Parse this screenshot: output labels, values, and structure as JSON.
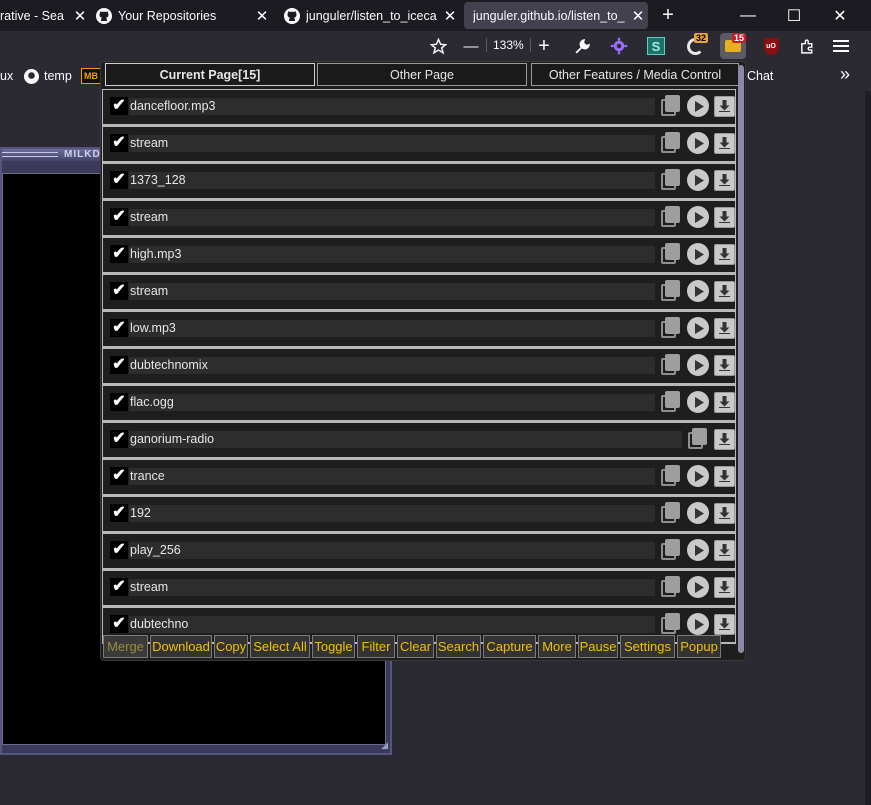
{
  "browser": {
    "tabs": [
      {
        "title": "rative - Sea",
        "active": false
      },
      {
        "title": "Your Repositories",
        "active": false
      },
      {
        "title": "junguler/listen_to_iceca",
        "active": false
      },
      {
        "title": "junguler.github.io/listen_to_",
        "active": true
      }
    ],
    "close_glyph": "✕",
    "new_tab_glyph": "+",
    "window_controls": {
      "minimize": "—",
      "maximize": "☐",
      "close": "✕"
    },
    "toolbar": {
      "zoom_level": "133%",
      "zoom_out": "—",
      "zoom_in": "+",
      "badge_counts": {
        "ext_a": "32",
        "ext_b": "15"
      },
      "icons": [
        "star-icon",
        "wrench-icon",
        "puzzle-gear-icon",
        "s-extension-icon",
        "circle-extension-icon",
        "media-grabber-icon",
        "ublock-icon",
        "extensions-icon",
        "menu-icon"
      ]
    },
    "bookmarks": [
      {
        "label": "ux"
      },
      {
        "label": "temp"
      },
      {
        "label": "MB"
      },
      {
        "label": "Chat"
      }
    ],
    "bookmarks_overflow": "»"
  },
  "milkdrop": {
    "title_text": "MILKD"
  },
  "popup": {
    "tabs": [
      {
        "label": "Current Page[15]",
        "active": true
      },
      {
        "label": "Other Page",
        "active": false
      },
      {
        "label": "Other Features / Media Control",
        "active": false
      }
    ],
    "check_glyph": "✔",
    "items": [
      {
        "name": "dancefloor.mp3",
        "checked": true,
        "has_play": true
      },
      {
        "name": "stream",
        "checked": true,
        "has_play": true
      },
      {
        "name": "1373_128",
        "checked": true,
        "has_play": true
      },
      {
        "name": "stream",
        "checked": true,
        "has_play": true
      },
      {
        "name": "high.mp3",
        "checked": true,
        "has_play": true
      },
      {
        "name": "stream",
        "checked": true,
        "has_play": true
      },
      {
        "name": "low.mp3",
        "checked": true,
        "has_play": true
      },
      {
        "name": "dubtechnomix",
        "checked": true,
        "has_play": true
      },
      {
        "name": "flac.ogg",
        "checked": true,
        "has_play": true
      },
      {
        "name": "ganorium-radio",
        "checked": true,
        "has_play": false
      },
      {
        "name": "trance",
        "checked": true,
        "has_play": true
      },
      {
        "name": "192",
        "checked": true,
        "has_play": true
      },
      {
        "name": "play_256",
        "checked": true,
        "has_play": true
      },
      {
        "name": "stream",
        "checked": true,
        "has_play": true
      },
      {
        "name": "dubtechno",
        "checked": true,
        "has_play": true
      }
    ],
    "actions": [
      {
        "label": "Merge",
        "enabled": false
      },
      {
        "label": "Download",
        "enabled": true
      },
      {
        "label": "Copy",
        "enabled": true
      },
      {
        "label": "Select All",
        "enabled": true
      },
      {
        "label": "Toggle",
        "enabled": true
      },
      {
        "label": "Filter",
        "enabled": true
      },
      {
        "label": "Clear",
        "enabled": true
      },
      {
        "label": "Search",
        "enabled": true
      },
      {
        "label": "Capture",
        "enabled": true
      },
      {
        "label": "More",
        "enabled": true
      },
      {
        "label": "Pause",
        "enabled": true
      },
      {
        "label": "Settings",
        "enabled": true
      },
      {
        "label": "Popup",
        "enabled": true
      }
    ],
    "colors": {
      "accent": "#f0c000",
      "dim": "#9a8a3a"
    }
  }
}
